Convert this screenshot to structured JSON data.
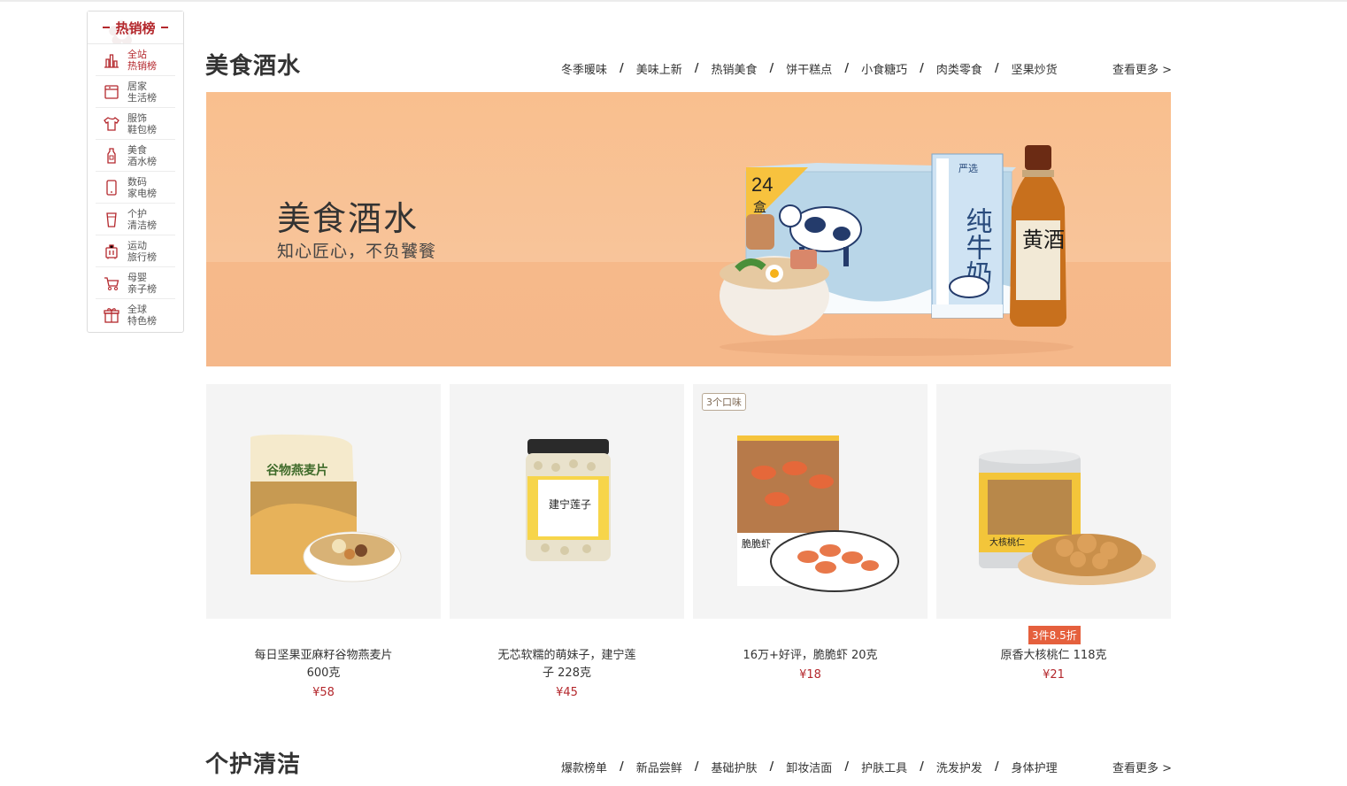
{
  "sidebar": {
    "title": "热销榜",
    "items": [
      {
        "line1": "全站",
        "line2": "热销榜",
        "icon": "bar-chart-icon",
        "active": true
      },
      {
        "line1": "居家",
        "line2": "生活榜",
        "icon": "cabinet-icon"
      },
      {
        "line1": "服饰",
        "line2": "鞋包榜",
        "icon": "shirt-icon"
      },
      {
        "line1": "美食",
        "line2": "酒水榜",
        "icon": "bottle-icon"
      },
      {
        "line1": "数码",
        "line2": "家电榜",
        "icon": "phone-icon"
      },
      {
        "line1": "个护",
        "line2": "清洁榜",
        "icon": "cup-icon"
      },
      {
        "line1": "运动",
        "line2": "旅行榜",
        "icon": "luggage-icon"
      },
      {
        "line1": "母婴",
        "line2": "亲子榜",
        "icon": "stroller-icon"
      },
      {
        "line1": "全球",
        "line2": "特色榜",
        "icon": "gift-icon"
      }
    ]
  },
  "food_section": {
    "title": "美食酒水",
    "tabs": [
      "冬季暖味",
      "美味上新",
      "热销美食",
      "饼干糕点",
      "小食糖巧",
      "肉类零食",
      "坚果炒货"
    ],
    "more": "查看更多 >",
    "banner": {
      "title": "美食酒水",
      "subtitle": "知心匠心，不负饕餮",
      "box_count_number": "24",
      "box_count_unit": "盒",
      "milk_label": "纯牛奶",
      "milk_brand": "严选",
      "wine_label": "黄酒",
      "bg_color": "#f9c192"
    },
    "products": [
      {
        "name": "每日坚果亚麻籽谷物燕麦片600克",
        "price": "¥58",
        "pack_label": "谷物燕麦片"
      },
      {
        "name": "无芯软糯的萌妹子，建宁莲子 228克",
        "price": "¥45",
        "pack_label": "建宁莲子"
      },
      {
        "name": "16万+好评，脆脆虾 20克",
        "price": "¥18",
        "tag": "3个口味",
        "pack_label": "脆脆虾"
      },
      {
        "name": "原香大核桃仁 118克",
        "price": "¥21",
        "promo": "3件8.5折",
        "pack_label": "大核桃仁"
      }
    ]
  },
  "care_section": {
    "title": "个护清洁",
    "tabs": [
      "爆款榜单",
      "新品尝鲜",
      "基础护肤",
      "卸妆洁面",
      "护肤工具",
      "洗发护发",
      "身体护理"
    ],
    "more": "查看更多 >"
  },
  "colors": {
    "accent": "#b4282d",
    "promo": "#e5603d",
    "card_bg": "#f4f4f4"
  }
}
